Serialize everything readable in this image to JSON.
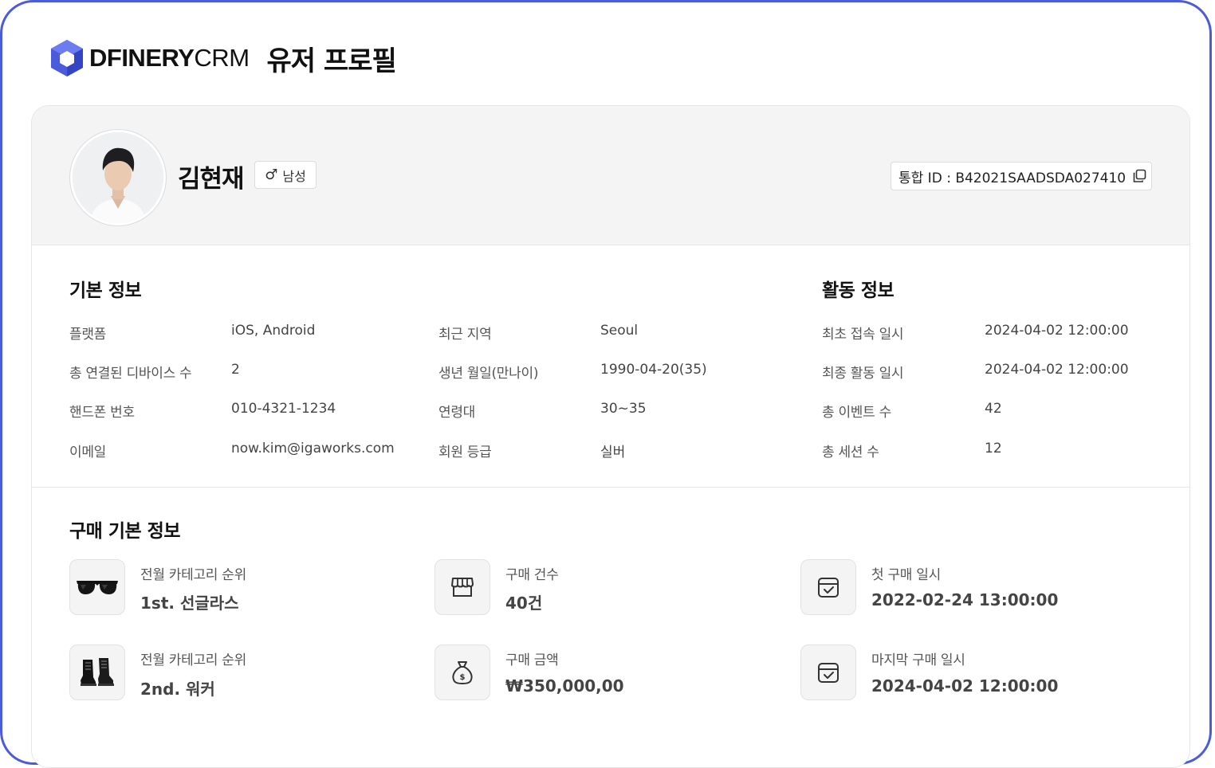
{
  "brand": {
    "logo_text_bold": "DFINERY",
    "logo_text_light": "CRM",
    "accent": "#4a5bdc"
  },
  "page": {
    "title": "유저 프로필"
  },
  "profile": {
    "name": "김현재",
    "gender_icon": "male-symbol-icon",
    "gender_label": "남성",
    "integrated_id_label": "통합 ID : B42021SAADSDA027410"
  },
  "basic_info": {
    "title": "기본 정보",
    "left": [
      {
        "label": "플랫폼",
        "value": "iOS, Android"
      },
      {
        "label": "총 연결된 디바이스 수",
        "value": "2"
      },
      {
        "label": "핸드폰 번호",
        "value": "010-4321-1234"
      },
      {
        "label": "이메일",
        "value": "now.kim@igaworks.com"
      }
    ],
    "right": [
      {
        "label": "최근 지역",
        "value": "Seoul"
      },
      {
        "label": "생년 월일(만나이)",
        "value": "1990-04-20(35)"
      },
      {
        "label": "연령대",
        "value": "30~35"
      },
      {
        "label": "회원 등급",
        "value": "실버"
      }
    ]
  },
  "activity_info": {
    "title": "활동 정보",
    "rows": [
      {
        "label": "최초 접속 일시",
        "value": "2024-04-02 12:00:00"
      },
      {
        "label": "최종 활동 일시",
        "value": "2024-04-02 12:00:00"
      },
      {
        "label": "총 이벤트 수",
        "value": "42"
      },
      {
        "label": "총 세션 수",
        "value": "12"
      }
    ]
  },
  "purchase_info": {
    "title": "구매 기본 정보",
    "items": [
      {
        "icon": "sunglasses-icon",
        "label": "전월 카테고리 순위",
        "value": "1st. 선글라스"
      },
      {
        "icon": "store-icon",
        "label": "구매 건수",
        "value": "40건"
      },
      {
        "icon": "calendar-check-icon",
        "label": "첫 구매 일시",
        "value": "2022-02-24 13:00:00"
      },
      {
        "icon": "boots-icon",
        "label": "전월 카테고리 순위",
        "value": "2nd. 워커"
      },
      {
        "icon": "money-bag-icon",
        "label": "구매 금액",
        "value": "₩350,000,00"
      },
      {
        "icon": "calendar-check-icon",
        "label": "마지막 구매 일시",
        "value": "2024-04-02 12:00:00"
      }
    ]
  }
}
